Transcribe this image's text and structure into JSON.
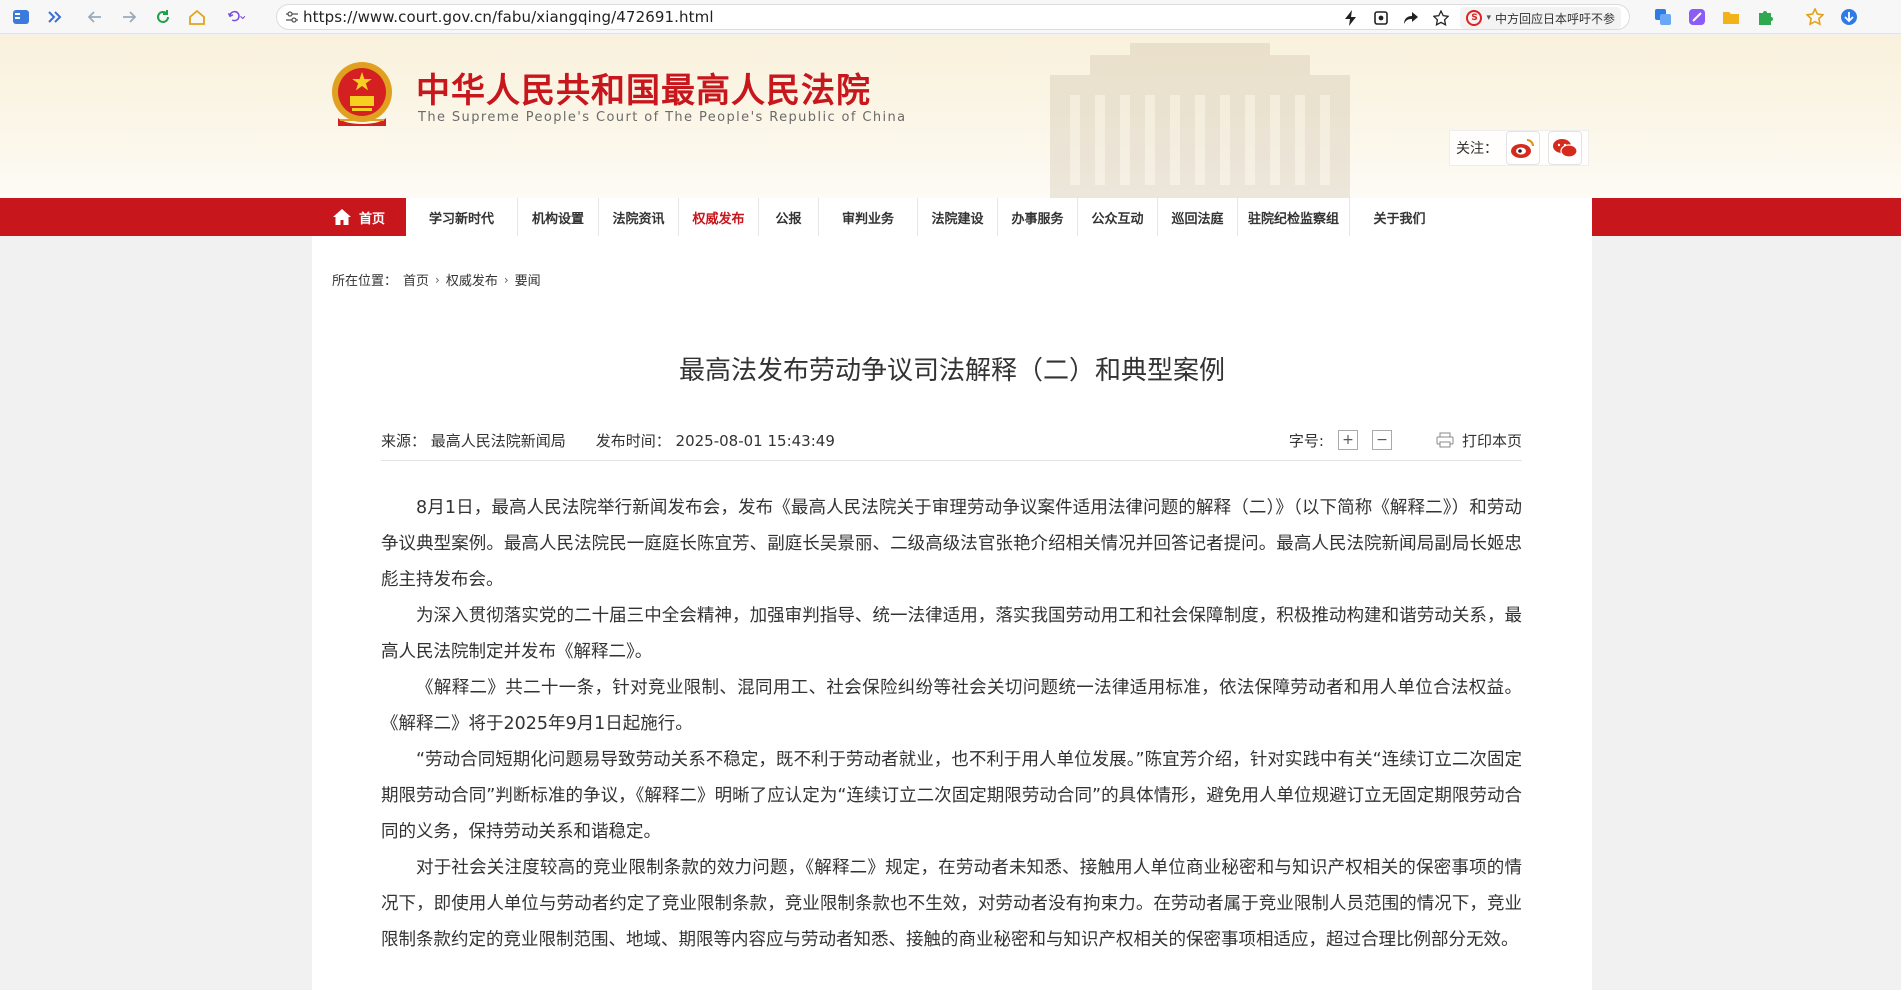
{
  "browser": {
    "url": "https://www.court.gov.cn/fabu/xiangqing/472691.html",
    "search_text": "中方回应日本呼吁不参"
  },
  "header": {
    "title": "中华人民共和国最高人民法院",
    "subtitle": "The Supreme People's Court of The People's Republic of China",
    "follow_label": "关注："
  },
  "nav": {
    "home": "首页",
    "items": [
      "学习新时代",
      "机构设置",
      "法院资讯",
      "权威发布",
      "公报",
      "审判业务",
      "法院建设",
      "办事服务",
      "公众互动",
      "巡回法庭",
      "驻院纪检监察组",
      "关于我们"
    ],
    "active": "权威发布"
  },
  "breadcrumb": {
    "label": "所在位置：",
    "items": [
      "首页",
      "权威发布",
      "要闻"
    ]
  },
  "article": {
    "title": "最高法发布劳动争议司法解释（二）和典型案例",
    "source": "来源：  最高人民法院新闻局",
    "time": "发布时间：  2025-08-01 15:43:49",
    "font_size_label": "字号:",
    "font_plus": "+",
    "font_minus": "−",
    "print_label": "打印本页",
    "paragraphs": [
      "8月1日，最高人民法院举行新闻发布会，发布《最高人民法院关于审理劳动争议案件适用法律问题的解释（二）》（以下简称《解释二》）和劳动争议典型案例。最高人民法院民一庭庭长陈宜芳、副庭长吴景丽、二级高级法官张艳介绍相关情况并回答记者提问。最高人民法院新闻局副局长姬忠彪主持发布会。",
      "为深入贯彻落实党的二十届三中全会精神，加强审判指导、统一法律适用，落实我国劳动用工和社会保障制度，积极推动构建和谐劳动关系，最高人民法院制定并发布《解释二》。",
      "《解释二》共二十一条，针对竞业限制、混同用工、社会保险纠纷等社会关切问题统一法律适用标准，依法保障劳动者和用人单位合法权益。《解释二》将于2025年9月1日起施行。",
      "“劳动合同短期化问题易导致劳动关系不稳定，既不利于劳动者就业，也不利于用人单位发展。”陈宜芳介绍，针对实践中有关“连续订立二次固定期限劳动合同”判断标准的争议，《解释二》明晰了应认定为“连续订立二次固定期限劳动合同”的具体情形，避免用人单位规避订立无固定期限劳动合同的义务，保持劳动关系和谐稳定。",
      "对于社会关注度较高的竞业限制条款的效力问题，《解释二》规定，在劳动者未知悉、接触用人单位商业秘密和与知识产权相关的保密事项的情况下，即使用人单位与劳动者约定了竞业限制条款，竞业限制条款也不生效，对劳动者没有拘束力。在劳动者属于竞业限制人员范围的情况下，竞业限制条款约定的竞业限制范围、地域、期限等内容应与劳动者知悉、接触的商业秘密和与知识产权相关的保密事项相适应，超过合理比例部分无效。"
    ]
  },
  "colors": {
    "brand_red": "#c8161d",
    "header_bg": "#f9f1dc"
  }
}
